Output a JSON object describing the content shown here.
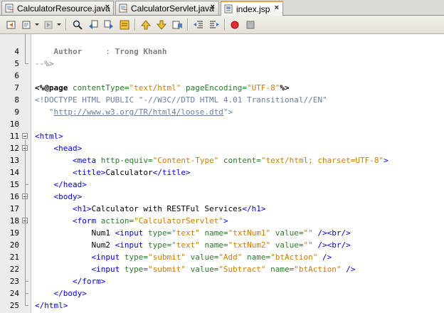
{
  "tabs": [
    {
      "label": "CalculatorResource.java",
      "close": "×",
      "active": false,
      "icon": "java-file-icon"
    },
    {
      "label": "CalculatorServlet.java",
      "close": "×",
      "active": false,
      "icon": "java-file-icon"
    },
    {
      "label": "index.jsp",
      "close": "×",
      "active": true,
      "icon": "jsp-file-icon"
    }
  ],
  "toolbar": {
    "icons": [
      "back-icon",
      "history-dropdown-icon",
      "forward-dropdown-icon",
      "find-icon",
      "find-previous-icon",
      "find-next-icon",
      "toggle-highlight-icon",
      "previous-bookmark-icon",
      "next-bookmark-icon",
      "toggle-bookmark-icon",
      "shift-left-icon",
      "shift-right-icon",
      "start-macro-icon",
      "stop-macro-icon"
    ]
  },
  "editor": {
    "lines": [
      {
        "num": "4",
        "fold": "none",
        "tokens": [
          [
            "plain",
            "    "
          ],
          [
            "author",
            "Author"
          ],
          [
            "comment",
            "     : "
          ],
          [
            "author",
            "Trong Khanh"
          ]
        ]
      },
      {
        "num": "5",
        "fold": "end",
        "tokens": [
          [
            "comment",
            "--%>"
          ]
        ]
      },
      {
        "num": "6",
        "fold": "none",
        "tokens": []
      },
      {
        "num": "7",
        "fold": "none",
        "tokens": [
          [
            "directive",
            "<%@page "
          ],
          [
            "attr",
            "contentType="
          ],
          [
            "str",
            "\"text/html\""
          ],
          [
            "attr",
            " pageEncoding="
          ],
          [
            "str",
            "\"UTF-8\""
          ],
          [
            "directive",
            "%>"
          ]
        ]
      },
      {
        "num": "8",
        "fold": "none",
        "tokens": [
          [
            "doctype",
            "<!DOCTYPE HTML PUBLIC \"-//W3C//DTD HTML 4.01 Transitional//EN\""
          ]
        ]
      },
      {
        "num": "9",
        "fold": "none",
        "tokens": [
          [
            "doctype",
            "   \""
          ],
          [
            "url",
            "http://www.w3.org/TR/html4/loose.dtd"
          ],
          [
            "doctype",
            "\">"
          ]
        ]
      },
      {
        "num": "10",
        "fold": "none",
        "tokens": []
      },
      {
        "num": "11",
        "fold": "start",
        "tokens": [
          [
            "tag",
            "<html>"
          ]
        ]
      },
      {
        "num": "12",
        "fold": "start",
        "tokens": [
          [
            "plain",
            "    "
          ],
          [
            "tag",
            "<head>"
          ]
        ]
      },
      {
        "num": "13",
        "fold": "none",
        "tokens": [
          [
            "plain",
            "        "
          ],
          [
            "tag",
            "<meta "
          ],
          [
            "attr",
            "http-equiv="
          ],
          [
            "str",
            "\"Content-Type\""
          ],
          [
            "attr",
            " content="
          ],
          [
            "str",
            "\"text/html; charset=UTF-8\""
          ],
          [
            "tag",
            ">"
          ]
        ]
      },
      {
        "num": "14",
        "fold": "none",
        "tokens": [
          [
            "plain",
            "        "
          ],
          [
            "tag",
            "<title>"
          ],
          [
            "plain",
            "Calculator"
          ],
          [
            "tag",
            "</title>"
          ]
        ]
      },
      {
        "num": "15",
        "fold": "end",
        "tokens": [
          [
            "plain",
            "    "
          ],
          [
            "tag",
            "</head>"
          ]
        ]
      },
      {
        "num": "16",
        "fold": "start",
        "tokens": [
          [
            "plain",
            "    "
          ],
          [
            "tag",
            "<body>"
          ]
        ]
      },
      {
        "num": "17",
        "fold": "none",
        "tokens": [
          [
            "plain",
            "        "
          ],
          [
            "tag",
            "<h1>"
          ],
          [
            "plain",
            "Calculator with RESTFul Services"
          ],
          [
            "tag",
            "</h1>"
          ]
        ]
      },
      {
        "num": "18",
        "fold": "start",
        "tokens": [
          [
            "plain",
            "        "
          ],
          [
            "tag",
            "<form "
          ],
          [
            "attr",
            "action="
          ],
          [
            "str",
            "\"CalculatorServlet\""
          ],
          [
            "tag",
            ">"
          ]
        ]
      },
      {
        "num": "19",
        "fold": "none",
        "tokens": [
          [
            "plain",
            "            Num1 "
          ],
          [
            "tag",
            "<input "
          ],
          [
            "attr",
            "type="
          ],
          [
            "str",
            "\"text\""
          ],
          [
            "attr",
            " name="
          ],
          [
            "str",
            "\"txtNum1\""
          ],
          [
            "attr",
            " value="
          ],
          [
            "str",
            "\"\""
          ],
          [
            "tag",
            " /><br/>"
          ]
        ]
      },
      {
        "num": "20",
        "fold": "none",
        "tokens": [
          [
            "plain",
            "            Num2 "
          ],
          [
            "tag",
            "<input "
          ],
          [
            "attr",
            "type="
          ],
          [
            "str",
            "\"text\""
          ],
          [
            "attr",
            " name="
          ],
          [
            "str",
            "\"txtNum2\""
          ],
          [
            "attr",
            " value="
          ],
          [
            "str",
            "\"\""
          ],
          [
            "tag",
            " /><br/>"
          ]
        ]
      },
      {
        "num": "21",
        "fold": "none",
        "tokens": [
          [
            "plain",
            "            "
          ],
          [
            "tag",
            "<input "
          ],
          [
            "attr",
            "type="
          ],
          [
            "str",
            "\"submit\""
          ],
          [
            "attr",
            " value="
          ],
          [
            "str",
            "\"Add\""
          ],
          [
            "attr",
            " name="
          ],
          [
            "str",
            "\"btAction\""
          ],
          [
            "tag",
            " />"
          ]
        ]
      },
      {
        "num": "22",
        "fold": "none",
        "tokens": [
          [
            "plain",
            "            "
          ],
          [
            "tag",
            "<input "
          ],
          [
            "attr",
            "type="
          ],
          [
            "str",
            "\"submit\""
          ],
          [
            "attr",
            " value="
          ],
          [
            "str",
            "\"Subtract\""
          ],
          [
            "attr",
            " name="
          ],
          [
            "str",
            "\"btAction\""
          ],
          [
            "tag",
            " />"
          ]
        ]
      },
      {
        "num": "23",
        "fold": "end",
        "tokens": [
          [
            "plain",
            "        "
          ],
          [
            "tag",
            "</form>"
          ]
        ]
      },
      {
        "num": "24",
        "fold": "end",
        "tokens": [
          [
            "plain",
            "    "
          ],
          [
            "tag",
            "</body>"
          ]
        ]
      },
      {
        "num": "25",
        "fold": "end",
        "tokens": [
          [
            "tag",
            "</html>"
          ]
        ]
      }
    ]
  },
  "colors": {
    "tag": "#0000e6",
    "attribute": "#2a7a2a",
    "string": "#ce7b00",
    "comment": "#808080",
    "doctype": "#6a7fa0",
    "active_tab_accent": "#f0a040"
  }
}
